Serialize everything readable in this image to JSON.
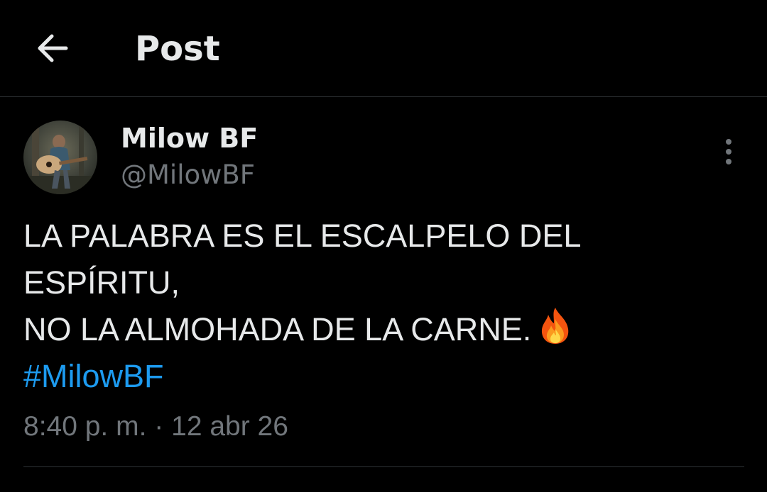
{
  "header": {
    "title": "Post",
    "back_icon": "arrow-left-icon"
  },
  "post": {
    "author": {
      "name": "Milow BF",
      "handle": "@MilowBF",
      "avatar_icon": "avatar-guitar-photo"
    },
    "more_icon": "vertical-ellipsis-icon",
    "body_lines": [
      "LA PALABRA ES EL ESCALPELO DEL",
      "ESPÍRITU,",
      "NO LA ALMOHADA DE LA CARNE."
    ],
    "emoji": "fire-emoji",
    "hashtag": "#MilowBF",
    "time": "8:40 p. m.",
    "separator": "·",
    "date": "12 abr 26"
  },
  "colors": {
    "background": "#000000",
    "text_primary": "#e7e9ea",
    "text_secondary": "#71767b",
    "link": "#1d9bf0",
    "divider": "#2f3336"
  }
}
